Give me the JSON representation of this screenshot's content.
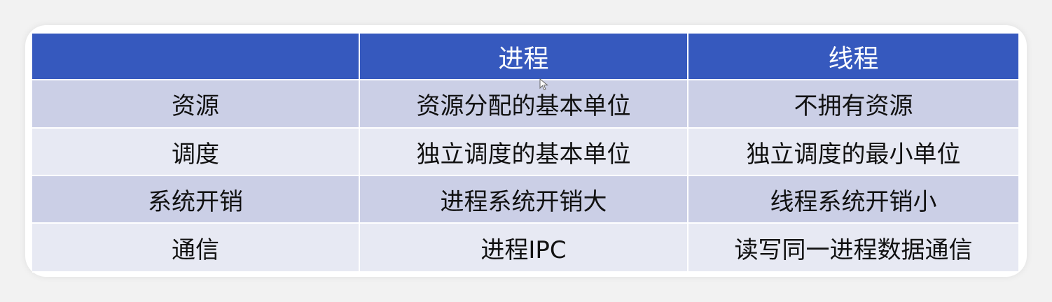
{
  "table": {
    "headers": [
      "",
      "进程",
      "线程"
    ],
    "rows": [
      [
        "资源",
        "资源分配的基本单位",
        "不拥有资源"
      ],
      [
        "调度",
        "独立调度的基本单位",
        "独立调度的最小单位"
      ],
      [
        "系统开销",
        "进程系统开销大",
        "线程系统开销小"
      ],
      [
        "通信",
        "进程IPC",
        "读写同一进程数据通信"
      ]
    ]
  },
  "colors": {
    "header_bg": "#3659be",
    "row_odd_bg": "#cbcfe6",
    "row_even_bg": "#e7e9f3"
  }
}
